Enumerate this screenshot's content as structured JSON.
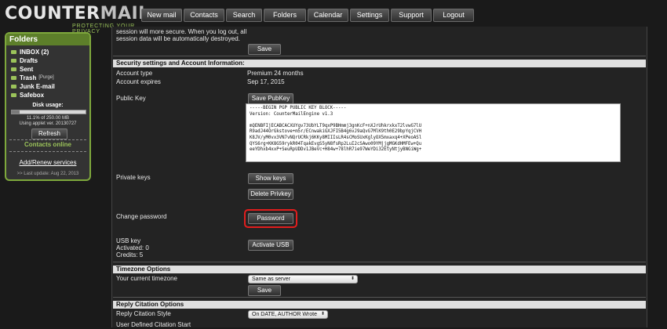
{
  "header": {
    "logo_counter": "COUNTER",
    "logo_mail": "MAIL",
    "tagline": "PROTECTING YOUR PRIVACY",
    "nav": [
      "New mail",
      "Contacts",
      "Search",
      "Folders",
      "Calendar",
      "Settings",
      "Support",
      "Logout"
    ]
  },
  "sidebar": {
    "title": "Folders",
    "folders": [
      {
        "name": "INBOX (2)"
      },
      {
        "name": "Drafts"
      },
      {
        "name": "Sent"
      },
      {
        "name": "Trash",
        "badge": "[Purge]"
      },
      {
        "name": "Junk E-mail"
      },
      {
        "name": "Safebox"
      }
    ],
    "disk_usage_label": "Disk usage:",
    "disk_usage_fraction": 0.111,
    "disk_usage_text": "11.1% of 250.00 MB",
    "applet_version": "Using applet ver. 20130727",
    "refresh_label": "Refresh",
    "contacts_online": "Contacts online",
    "add_renew": "Add/Renew services",
    "last_update": ">> Last update: Aug 22, 2013"
  },
  "main": {
    "session_line1": "session will more secure. When you log out, all",
    "session_line2": "session data will be automatically destroyed.",
    "save_label": "Save",
    "security_header": "Security settings and Account Information:",
    "account_type_label": "Account type",
    "account_type_value": "Premium 24 months",
    "account_expires_label": "Account expires",
    "account_expires_value": "Sep 17, 2015",
    "public_key_label": "Public Key",
    "save_pubkey_label": "Save PubKey",
    "pubkey_text": "-----BEGIN PGP PUBLIC KEY BLOCK-----\nVersion: CounterMailEngine v1.3\n\nmQENBFIjECABCACXUYgv73UbYLT9qxP9BHmmj3gnKcF+nXJrUhkrxkxT2lvwG7lU\nR9adJ44OrGkstove+m5r/ECnwakiGXJFI5B4g6vJ9aQvG7MlK9th0E29bpYqjCVH\nK8JV/yM0vx3VN7vNQrUCRkj6KKy8MIIIsLR4sCMoSUxKglyOX5mxaxq4+XPeoASl\nQYS6rg+KK8G59rykR04TqakEvgS5yN8fsRp2LuI2cSAwo09YMjjgMGKdHMFEw+Qu\neeYDhxb4xxP+SeuRpUDDv1JBeVc+H84w+78lhR7ie97WeYDi32EtyNtjyBNGiWg+",
    "private_keys_label": "Private keys",
    "show_keys_label": "Show keys",
    "delete_privkey_label": "Delete Privkey",
    "change_password_label": "Change password",
    "password_button_label": "Password",
    "usb_key_label": "USB key",
    "usb_activated": "Activated: 0",
    "usb_credits": "Credits: 5",
    "activate_usb_label": "Activate USB",
    "timezone_header": "Timezone Options",
    "timezone_label": "Your current timezone",
    "timezone_value": "Same as server",
    "timezone_save_label": "Save",
    "reply_header": "Reply Citation Options",
    "reply_style_label": "Reply Citation Style",
    "reply_style_value": "On DATE, AUTHOR Wrote",
    "user_defined_label": "User Defined Citation Start"
  }
}
